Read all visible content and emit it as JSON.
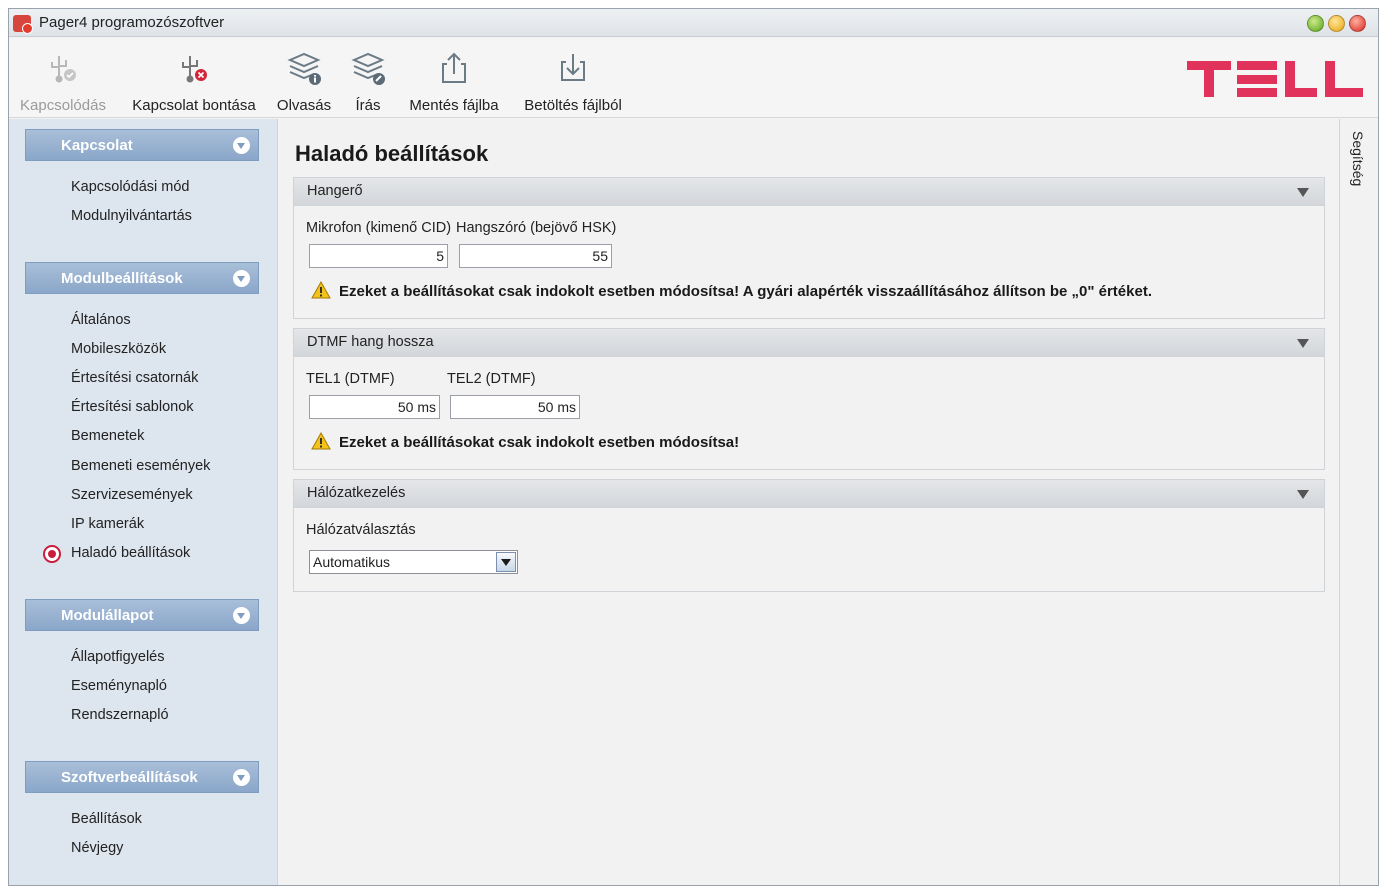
{
  "window": {
    "title": "Pager4 programozószoftver"
  },
  "toolbar": {
    "buttons": [
      {
        "label": "Kapcsolódás",
        "icon": "usb-connect-icon",
        "enabled": false
      },
      {
        "label": "Kapcsolat bontása",
        "icon": "usb-disconnect-icon",
        "enabled": true
      },
      {
        "label": "Olvasás",
        "icon": "read-layers-icon",
        "enabled": true
      },
      {
        "label": "Írás",
        "icon": "write-layers-icon",
        "enabled": true
      },
      {
        "label": "Mentés fájlba",
        "icon": "export-icon",
        "enabled": true
      },
      {
        "label": "Betöltés fájlból",
        "icon": "import-icon",
        "enabled": true
      }
    ],
    "logo": "TELL"
  },
  "sidebar": {
    "sections": [
      {
        "title": "Kapcsolat",
        "items": [
          "Kapcsolódási mód",
          "Modulnyilvántartás"
        ]
      },
      {
        "title": "Modulbeállítások",
        "items": [
          "Általános",
          "Mobileszközök",
          "Értesítési csatornák",
          "Értesítési sablonok",
          "Bemenetek",
          "Bemeneti események",
          "Szervizesemények",
          "IP kamerák",
          "Haladó beállítások"
        ]
      },
      {
        "title": "Modulállapot",
        "items": [
          "Állapotfigyelés",
          "Eseménynapló",
          "Rendszernapló"
        ]
      },
      {
        "title": "Szoftverbeállítások",
        "items": [
          "Beállítások",
          "Névjegy"
        ]
      }
    ],
    "selected": "Haladó beállítások"
  },
  "main": {
    "title": "Haladó beállítások",
    "volume": {
      "header": "Hangerő",
      "mic_label": "Mikrofon (kimenő CID)",
      "mic_value": "5",
      "speaker_label": "Hangszóró (bejövő HSK)",
      "speaker_value": "55",
      "warning": "Ezeket a beállításokat csak indokolt esetben módosítsa! A gyári alapérték visszaállításához állítson be „0\" értéket."
    },
    "dtmf": {
      "header": "DTMF hang hossza",
      "tel1_label": "TEL1 (DTMF)",
      "tel1_value": "50 ms",
      "tel2_label": "TEL2 (DTMF)",
      "tel2_value": "50 ms",
      "warning": "Ezeket a beállításokat csak indokolt esetben módosítsa!"
    },
    "network": {
      "header": "Hálózatkezelés",
      "select_label": "Hálózatválasztás",
      "select_value": "Automatikus"
    }
  },
  "help": {
    "label": "Segítség"
  },
  "colors": {
    "accent": "#c81e3c",
    "logo": "#e0325a",
    "sidebar_header": "#8aa6c9",
    "sidebar_bg": "#dde5ef"
  }
}
